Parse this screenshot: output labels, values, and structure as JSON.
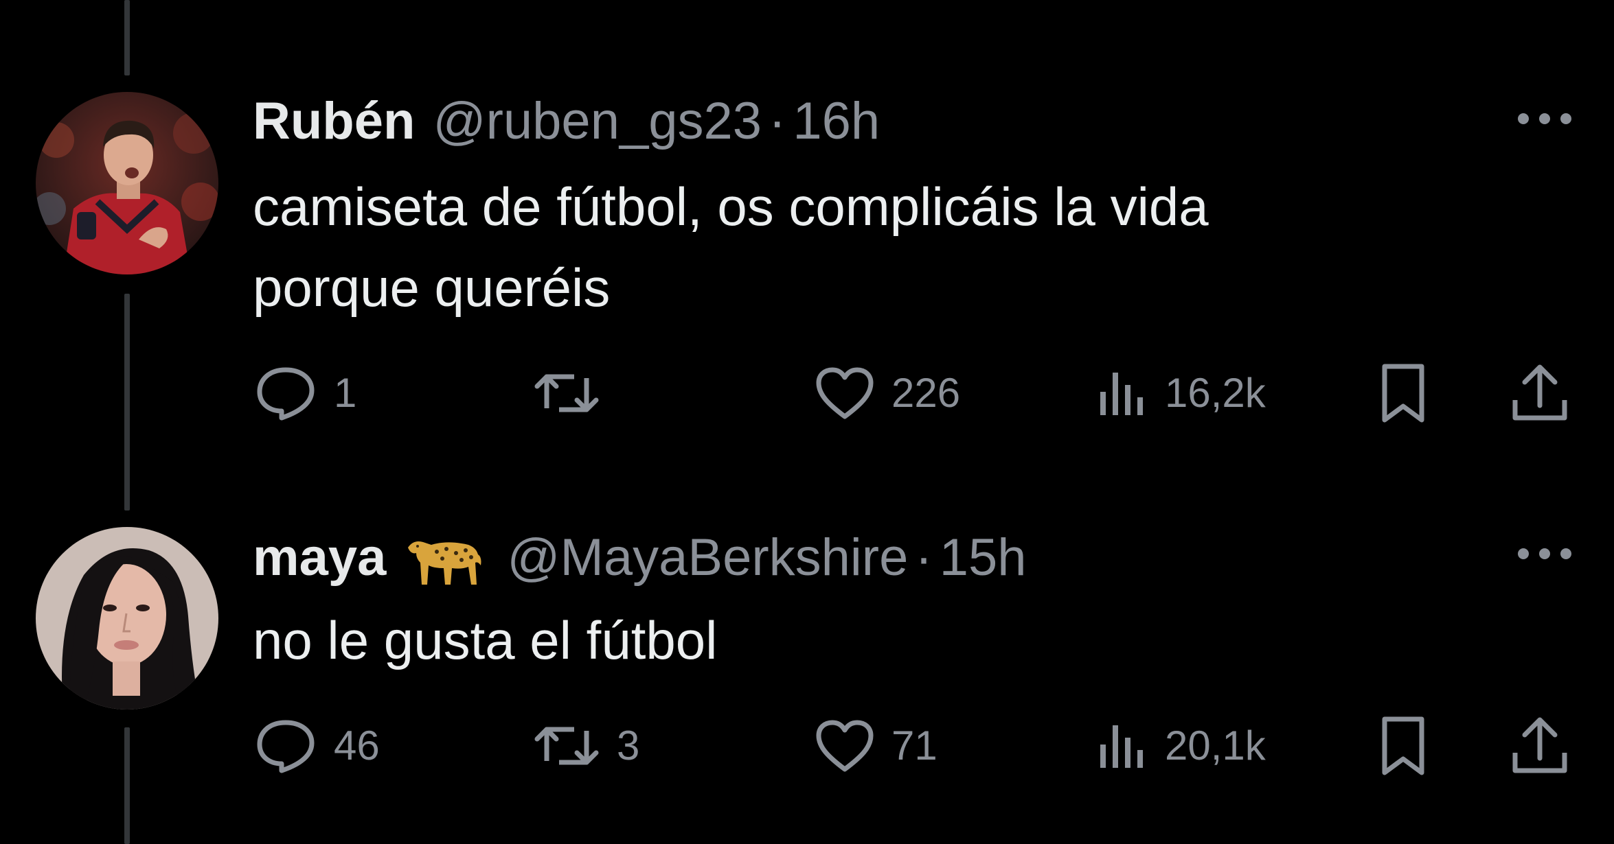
{
  "tweets": [
    {
      "name": "Rubén",
      "badge": "",
      "handle": "@ruben_gs23",
      "separator": "·",
      "time": "16h",
      "text_lines": [
        "camiseta de fútbol, os complicáis la vida",
        "porque queréis"
      ],
      "replies": "1",
      "reposts": "",
      "likes": "226",
      "views": "16,2k"
    },
    {
      "name": "maya",
      "badge": "leopard-emoji",
      "handle": "@MayaBerkshire",
      "separator": "·",
      "time": "15h",
      "text_lines": [
        "no le gusta el fútbol"
      ],
      "replies": "46",
      "reposts": "3",
      "likes": "71",
      "views": "20,1k"
    }
  ],
  "icons": {
    "reply": "speech-bubble-icon",
    "repost": "repost-arrows-icon",
    "like": "heart-icon",
    "views": "bar-chart-icon",
    "bookmark": "bookmark-icon",
    "share": "share-upload-icon",
    "more": "more-dots-icon"
  },
  "colors": {
    "background": "#000000",
    "text": "#e7e9ea",
    "secondary": "#8b9098",
    "thread_line": "#333639"
  }
}
